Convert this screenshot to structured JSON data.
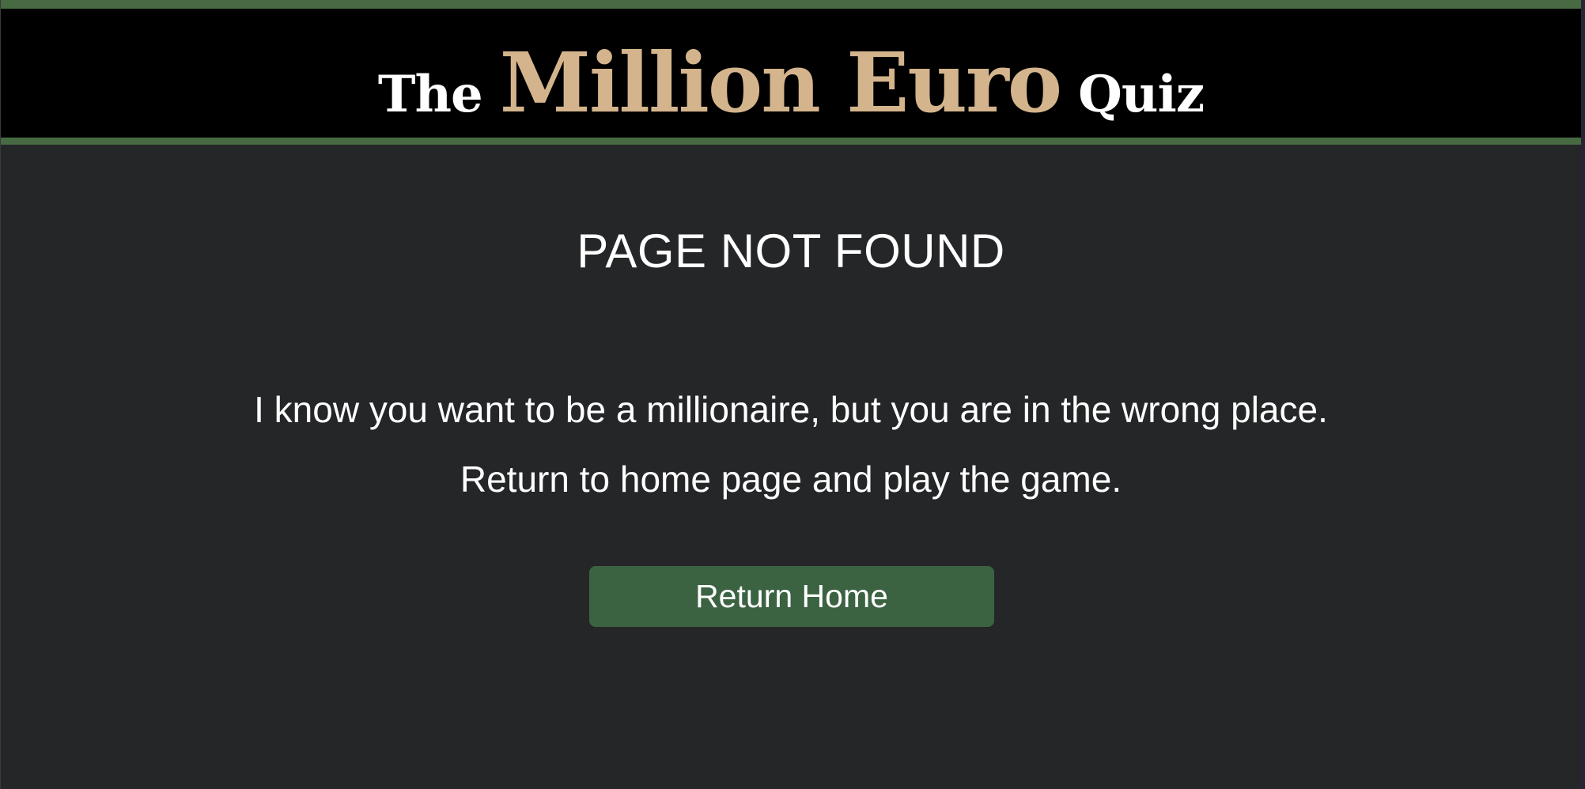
{
  "header": {
    "logo_the": "The",
    "logo_million_euro": "Million Euro",
    "logo_quiz": "Quiz"
  },
  "main": {
    "title": "PAGE NOT FOUND",
    "message_line_1": "I know you want to be a millionaire, but you are in the wrong place.",
    "message_line_2": "Return to home page and play the game.",
    "return_button_label": "Return Home"
  },
  "colors": {
    "header_background": "#000000",
    "header_border_green": "#476a43",
    "logo_gold": "#d4b48c",
    "page_background": "#252628",
    "button_green": "#3b6342",
    "text": "#ffffff"
  }
}
